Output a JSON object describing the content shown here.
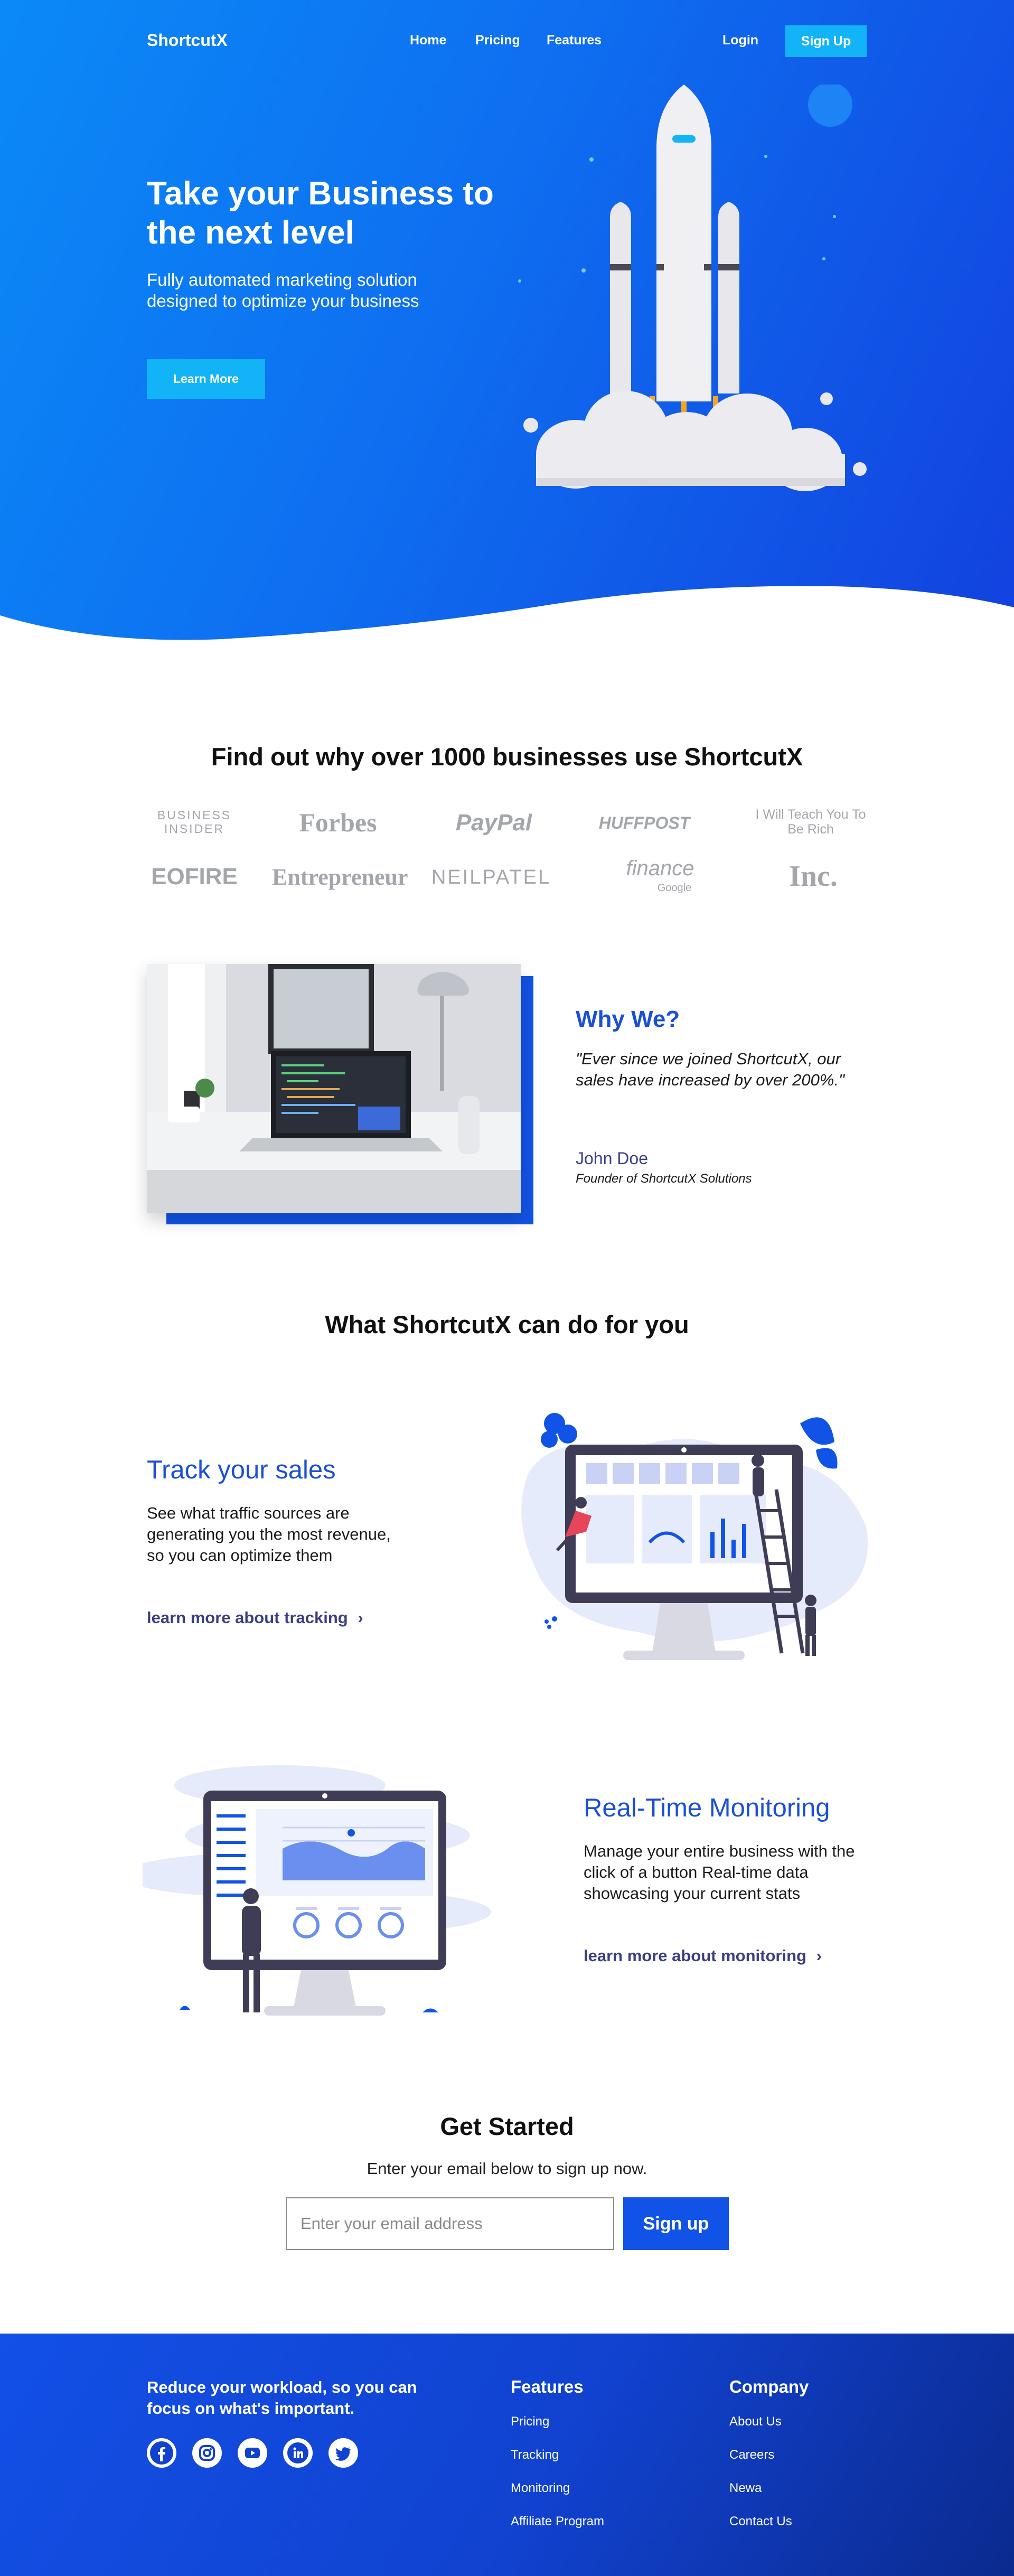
{
  "nav": {
    "logo": "ShortcutX",
    "links": [
      {
        "label": "Home"
      },
      {
        "label": "Pricing"
      },
      {
        "label": "Features"
      }
    ],
    "login": "Login",
    "signup": "Sign Up"
  },
  "hero": {
    "title": "Take your Business to the next level",
    "subtitle": "Fully automated marketing solution designed to optimize your business",
    "cta": "Learn More"
  },
  "press": {
    "heading": "Find out why over 1000 businesses use ShortcutX",
    "brands": [
      "BUSINESS INSIDER",
      "Forbes",
      "PayPal",
      "HUFFPOST",
      "I Will Teach You To Be Rich",
      "EOFIRE",
      "Entrepreneur",
      "NEILPATEL",
      "finance",
      "Inc."
    ],
    "brand_extra": {
      "finance_sub": "Google"
    }
  },
  "why": {
    "title": "Why We?",
    "quote": "\"Ever since we joined ShortcutX, our sales have increased by over 200%.\"",
    "name": "John Doe",
    "role": "Founder of ShortcutX Solutions"
  },
  "features": {
    "heading": "What ShortcutX can do for you",
    "items": [
      {
        "title": "Track your sales",
        "text": "See what traffic sources are generating you the most revenue, so you can optimize them",
        "link": "learn more about tracking",
        "link_icon": "chevron-right-icon"
      },
      {
        "title": "Real-Time Monitoring",
        "text": "Manage your entire business with the click of a button Real-time data showcasing your current stats",
        "link": "learn more about monitoring",
        "link_icon": "chevron-right-icon"
      }
    ]
  },
  "get_started": {
    "title": "Get Started",
    "subtitle": "Enter your email below to sign up now.",
    "placeholder": "Enter your email address",
    "button": "Sign up"
  },
  "footer": {
    "tagline": "Reduce your workload, so you can focus on what's important.",
    "social": [
      "facebook-icon",
      "instagram-icon",
      "youtube-icon",
      "linkedin-icon",
      "twitter-icon"
    ],
    "columns": [
      {
        "title": "Features",
        "links": [
          "Pricing",
          "Tracking",
          "Monitoring",
          "Affiliate Program"
        ]
      },
      {
        "title": "Company",
        "links": [
          "About Us",
          "Careers",
          "Newa",
          "Contact Us"
        ]
      }
    ]
  },
  "colors": {
    "primary": "#1153e6",
    "accent": "#13b4f7",
    "hero_start": "#0b8af7",
    "hero_end": "#1341df",
    "link_dark": "#3a3f80"
  }
}
